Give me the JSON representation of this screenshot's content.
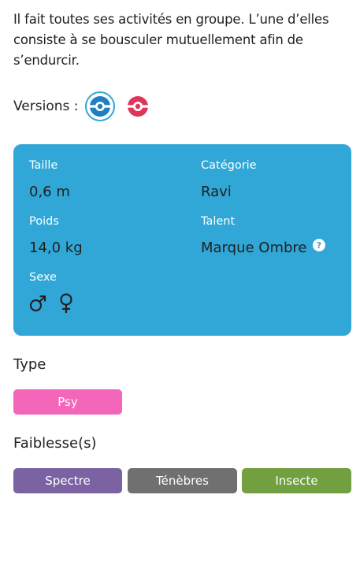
{
  "description": "Il fait toutes ses activités en groupe. L’une d’elles consiste à se bousculer mutuellement afin de s’endurcir.",
  "versions": {
    "label": "Versions :",
    "items": [
      {
        "icon": "pokeball-blue-icon",
        "color": "#1f7fbf",
        "selected": true
      },
      {
        "icon": "pokeball-red-icon",
        "color": "#e3350d",
        "selected": false
      }
    ]
  },
  "info": {
    "taille_label": "Taille",
    "taille_value": "0,6 m",
    "poids_label": "Poids",
    "poids_value": "14,0 kg",
    "sexe_label": "Sexe",
    "sexe_values": [
      "male",
      "female"
    ],
    "categorie_label": "Catégorie",
    "categorie_value": "Ravi",
    "talent_label": "Talent",
    "talent_value": "Marque Ombre",
    "card_color": "#30a7d7"
  },
  "type": {
    "title": "Type",
    "items": [
      {
        "label": "Psy",
        "color": "#f366b9"
      }
    ]
  },
  "weaknesses": {
    "title": "Faiblesse(s)",
    "items": [
      {
        "label": "Spectre",
        "color": "#7b62a3"
      },
      {
        "label": "Ténèbres",
        "color": "#707070"
      },
      {
        "label": "Insecte",
        "color": "#729f3f"
      }
    ]
  }
}
